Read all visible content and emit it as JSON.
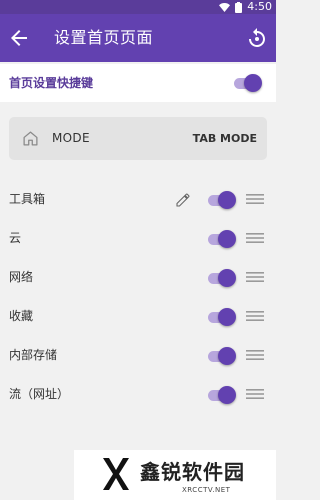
{
  "status_bar": {
    "time": "4:50",
    "icons": [
      "wifi-icon",
      "battery-icon"
    ]
  },
  "app_bar": {
    "title": "设置首页页面",
    "back_icon": "arrow-back-icon",
    "reset_icon": "reset-icon"
  },
  "master_toggle": {
    "label": "首页设置快捷键",
    "enabled": true
  },
  "mode_card": {
    "icon": "home-icon",
    "label": "MODE",
    "value": "TAB MODE"
  },
  "items": [
    {
      "label": "工具箱",
      "enabled": true,
      "editable": true
    },
    {
      "label": "云",
      "enabled": true,
      "editable": false
    },
    {
      "label": "网络",
      "enabled": true,
      "editable": false
    },
    {
      "label": "收藏",
      "enabled": true,
      "editable": false
    },
    {
      "label": "内部存储",
      "enabled": true,
      "editable": false
    },
    {
      "label": "流（网址）",
      "enabled": true,
      "editable": false
    }
  ],
  "watermark": {
    "brand": "鑫锐软件园",
    "site": "XRCCTV.NET"
  },
  "colors": {
    "accent": "#6241b0",
    "status_bar": "#5a3c9a",
    "switch_track": "#b7a6dd",
    "card": "#e3e3e3",
    "background": "#f1f1f1"
  }
}
